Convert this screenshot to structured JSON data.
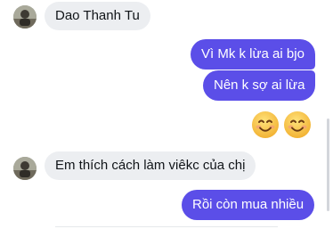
{
  "messages": [
    {
      "side": "incoming",
      "sender": "Dao Thanh Tu",
      "text": "Dao Thanh Tu"
    },
    {
      "side": "outgoing",
      "text": "Vì Mk k lừa ai bjo"
    },
    {
      "side": "outgoing",
      "text": "Nên k sợ ai lừa"
    },
    {
      "side": "outgoing",
      "type": "emoji",
      "emojis": [
        "smiling-face-icon",
        "smiling-face-icon"
      ]
    },
    {
      "side": "incoming",
      "text": "Em thích cách làm viêkc của chị"
    },
    {
      "side": "outgoing",
      "text": "Rồi còn mua nhiều"
    }
  ],
  "colors": {
    "outgoing_bubble": "#5b4ee8",
    "incoming_bubble": "#eceef1",
    "emoji_face": "#f7c443"
  }
}
